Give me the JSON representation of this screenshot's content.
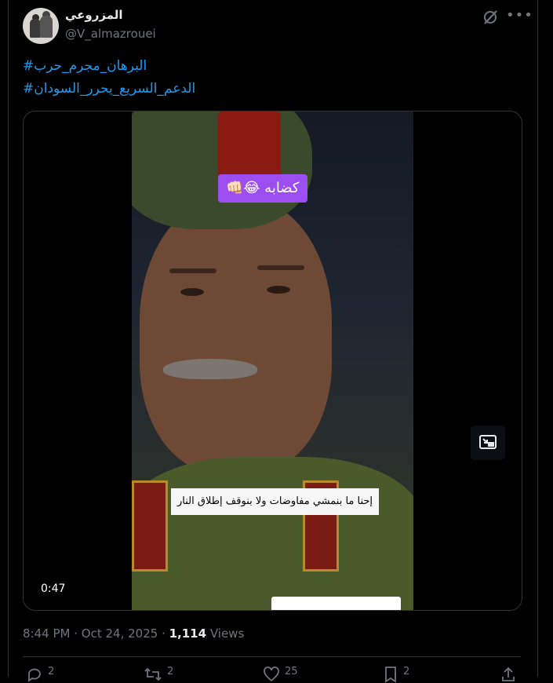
{
  "author": {
    "display_name": "المزروعي",
    "handle": "@V_almazrouei"
  },
  "header_icons": [
    "grok-icon",
    "more-icon"
  ],
  "tweet": {
    "hashtags": [
      "#البرهان_مجرم_حرب",
      "#الدعم_السريع_يحرر_السودان"
    ]
  },
  "video": {
    "top_caption": "كضابه 😂👊🏻",
    "bottom_caption": "إحنا ما بنمشي مفاوضات ولا بنوقف إطلاق النار",
    "duration": "0:47"
  },
  "meta": {
    "time": "8:44 PM",
    "date": "Oct 24, 2025",
    "views_count": "1,114",
    "views_label": "Views"
  },
  "actions": {
    "replies": "2",
    "reposts": "2",
    "likes": "25",
    "bookmarks": "2"
  },
  "colors": {
    "background": "#000000",
    "text": "#e7e9ea",
    "muted": "#71767b",
    "link": "#1d9bf0",
    "border": "#2f3336",
    "caption_purple": "#9d4ef0"
  }
}
